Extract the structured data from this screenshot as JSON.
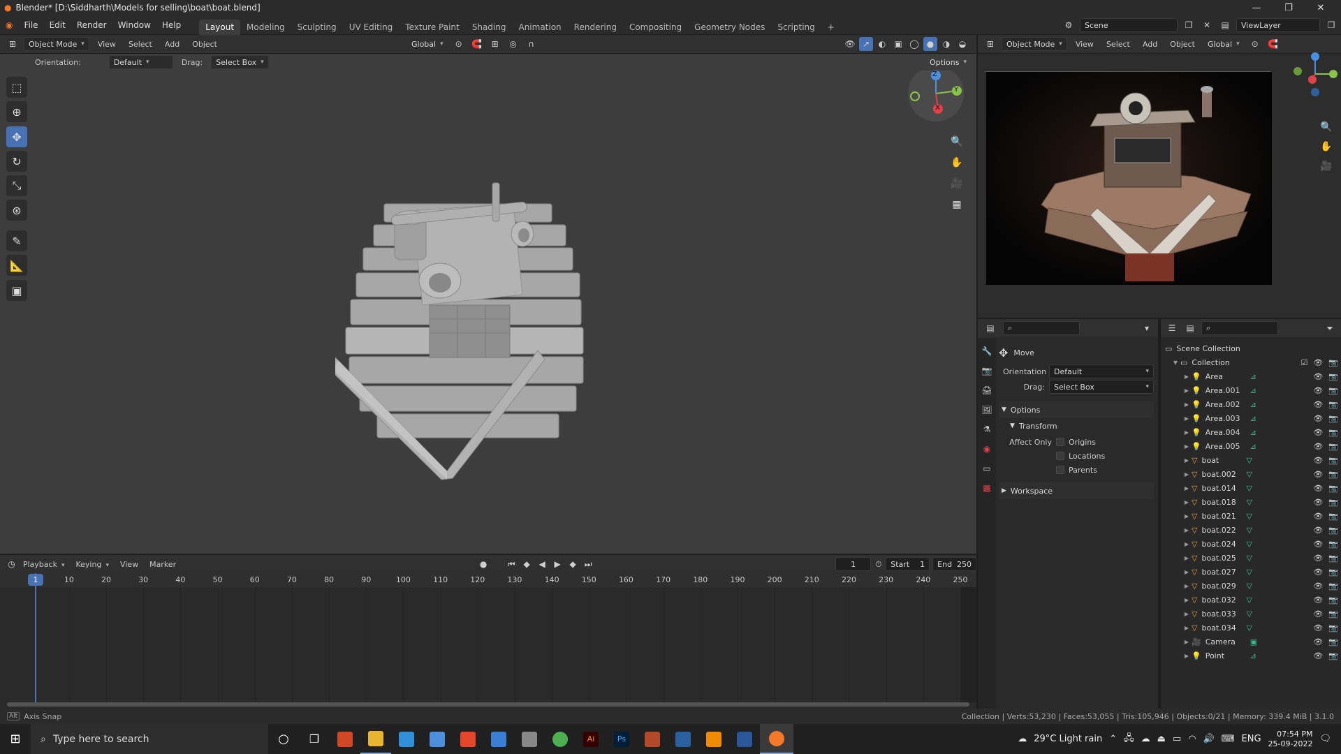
{
  "window": {
    "title": "Blender* [D:\\Siddharth\\Models for selling\\boat\\boat.blend]",
    "minimize": "—",
    "maximize": "❐",
    "close": "✕"
  },
  "menu": {
    "items": [
      "File",
      "Edit",
      "Render",
      "Window",
      "Help"
    ]
  },
  "workspaces": {
    "tabs": [
      "Layout",
      "Modeling",
      "Sculpting",
      "UV Editing",
      "Texture Paint",
      "Shading",
      "Animation",
      "Rendering",
      "Compositing",
      "Geometry Nodes",
      "Scripting"
    ],
    "active": "Layout",
    "add": "+"
  },
  "scene": {
    "label": "Scene",
    "view_layer": "ViewLayer"
  },
  "viewport": {
    "mode": "Object Mode",
    "menus": [
      "View",
      "Select",
      "Add",
      "Object"
    ],
    "transform_orientation": "Global",
    "tool_settings": {
      "orientation_label": "Orientation:",
      "orientation_value": "Default",
      "drag_label": "Drag:",
      "drag_value": "Select Box",
      "options": "Options"
    },
    "gizmo_axes": {
      "z": "Z",
      "y": "Y",
      "x": "X"
    }
  },
  "render_preview": {
    "mode": "Object Mode",
    "menus": [
      "View",
      "Select",
      "Add",
      "Object"
    ],
    "transform_orientation": "Global"
  },
  "properties": {
    "tool_name": "Move",
    "orientation_label": "Orientation",
    "orientation_value": "Default",
    "drag_label": "Drag:",
    "drag_value": "Select Box",
    "options_panel": "Options",
    "transform_panel": "Transform",
    "affect_only_label": "Affect Only",
    "affect_only": [
      "Origins",
      "Locations",
      "Parents"
    ],
    "workspace_panel": "Workspace"
  },
  "outliner": {
    "root": "Scene Collection",
    "collection": "Collection",
    "items": [
      {
        "name": "Area",
        "type": "light"
      },
      {
        "name": "Area.001",
        "type": "light"
      },
      {
        "name": "Area.002",
        "type": "light"
      },
      {
        "name": "Area.003",
        "type": "light"
      },
      {
        "name": "Area.004",
        "type": "light"
      },
      {
        "name": "Area.005",
        "type": "light"
      },
      {
        "name": "boat",
        "type": "mesh"
      },
      {
        "name": "boat.002",
        "type": "mesh"
      },
      {
        "name": "boat.014",
        "type": "mesh"
      },
      {
        "name": "boat.018",
        "type": "mesh"
      },
      {
        "name": "boat.021",
        "type": "mesh"
      },
      {
        "name": "boat.022",
        "type": "mesh"
      },
      {
        "name": "boat.024",
        "type": "mesh"
      },
      {
        "name": "boat.025",
        "type": "mesh"
      },
      {
        "name": "boat.027",
        "type": "mesh"
      },
      {
        "name": "boat.029",
        "type": "mesh"
      },
      {
        "name": "boat.032",
        "type": "mesh"
      },
      {
        "name": "boat.033",
        "type": "mesh"
      },
      {
        "name": "boat.034",
        "type": "mesh"
      },
      {
        "name": "Camera",
        "type": "camera"
      },
      {
        "name": "Point",
        "type": "light"
      }
    ]
  },
  "timeline": {
    "menus": [
      "Playback",
      "Keying",
      "View",
      "Marker"
    ],
    "current_frame": "1",
    "start_label": "Start",
    "start": "1",
    "end_label": "End",
    "end": "250",
    "ticks": [
      "1",
      "10",
      "20",
      "30",
      "40",
      "50",
      "60",
      "70",
      "80",
      "90",
      "100",
      "110",
      "120",
      "130",
      "140",
      "150",
      "160",
      "170",
      "180",
      "190",
      "200",
      "210",
      "220",
      "230",
      "240",
      "250"
    ]
  },
  "status": {
    "left": "Axis Snap",
    "right": "Collection | Verts:53,230 | Faces:53,055 | Tris:105,946 | Objects:0/21 | Memory: 339.4 MiB | 3.1.0"
  },
  "taskbar": {
    "search_placeholder": "Type here to search",
    "weather": "29°C  Light rain",
    "language": "ENG",
    "time": "07:54 PM",
    "date": "25-09-2022"
  },
  "colors": {
    "accent": "#4772b3",
    "viewport_bg": "#3d3d3d",
    "x_axis": "#e0414a",
    "y_axis": "#8bc34a",
    "z_axis": "#4a90e2"
  }
}
